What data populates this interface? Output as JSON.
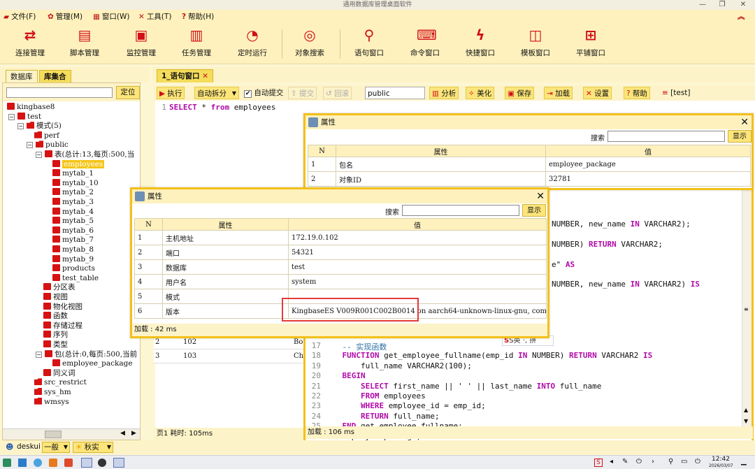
{
  "window": {
    "title": "通用数据库管理桌面软件"
  },
  "menu": [
    {
      "label": "文件(F)",
      "icon": "folder-icon"
    },
    {
      "label": "管理(M)",
      "icon": "gear-icon"
    },
    {
      "label": "窗口(W)",
      "icon": "windows-icon"
    },
    {
      "label": "工具(T)",
      "icon": "tools-icon"
    },
    {
      "label": "帮助(H)",
      "icon": "help-icon"
    }
  ],
  "toolbar": [
    {
      "label": "连接管理",
      "icon": "connect-icon"
    },
    {
      "label": "脚本管理",
      "icon": "script-icon"
    },
    {
      "label": "监控管理",
      "icon": "monitor-icon"
    },
    {
      "label": "任务管理",
      "icon": "calendar-icon"
    },
    {
      "label": "定时运行",
      "icon": "clock-icon"
    },
    {
      "label": "对象搜索",
      "icon": "object-search-icon"
    },
    {
      "label": "语句窗口",
      "icon": "search-icon"
    },
    {
      "label": "命令窗口",
      "icon": "command-icon"
    },
    {
      "label": "快捷窗口",
      "icon": "lightning-icon"
    },
    {
      "label": "模板窗口",
      "icon": "template-icon"
    },
    {
      "label": "平铺窗口",
      "icon": "tile-icon"
    }
  ],
  "left": {
    "tabs": [
      "数据库",
      "库集合"
    ],
    "locate_button": "定位",
    "tree": [
      {
        "label": "kingbase8",
        "level": 0,
        "icon": "server"
      },
      {
        "label": "test",
        "level": 1,
        "icon": "db",
        "exp": "−"
      },
      {
        "label": "模式(5)",
        "level": 2,
        "icon": "fold",
        "exp": "−"
      },
      {
        "label": "perf",
        "level": 3,
        "icon": "fold"
      },
      {
        "label": "public",
        "level": 3,
        "icon": "fold",
        "exp": "−"
      },
      {
        "label": "表(总计:13,每页:500,当",
        "level": 4,
        "icon": "tbl",
        "exp": "−"
      },
      {
        "label": "employees",
        "level": 5,
        "icon": "tbl",
        "selected": true
      },
      {
        "label": "mytab_1",
        "level": 5,
        "icon": "tbl"
      },
      {
        "label": "mytab_10",
        "level": 5,
        "icon": "tbl"
      },
      {
        "label": "mytab_2",
        "level": 5,
        "icon": "tbl"
      },
      {
        "label": "mytab_3",
        "level": 5,
        "icon": "tbl"
      },
      {
        "label": "mytab_4",
        "level": 5,
        "icon": "tbl"
      },
      {
        "label": "mytab_5",
        "level": 5,
        "icon": "tbl"
      },
      {
        "label": "mytab_6",
        "level": 5,
        "icon": "tbl"
      },
      {
        "label": "mytab_7",
        "level": 5,
        "icon": "tbl"
      },
      {
        "label": "mytab_8",
        "level": 5,
        "icon": "tbl"
      },
      {
        "label": "mytab_9",
        "level": 5,
        "icon": "tbl"
      },
      {
        "label": "products",
        "level": 5,
        "icon": "tbl"
      },
      {
        "label": "test_table",
        "level": 5,
        "icon": "tbl"
      },
      {
        "label": "分区表",
        "level": 4,
        "icon": "tbl"
      },
      {
        "label": "视图",
        "level": 4,
        "icon": "tbl"
      },
      {
        "label": "物化视图",
        "level": 4,
        "icon": "tbl"
      },
      {
        "label": "函数",
        "level": 4,
        "icon": "tbl"
      },
      {
        "label": "存储过程",
        "level": 4,
        "icon": "tbl"
      },
      {
        "label": "序列",
        "level": 4,
        "icon": "tbl"
      },
      {
        "label": "类型",
        "level": 4,
        "icon": "tbl"
      },
      {
        "label": "包(总计:0,每页:500,当前",
        "level": 4,
        "icon": "tbl",
        "exp": "−"
      },
      {
        "label": "employee_package",
        "level": 5,
        "icon": "tbl"
      },
      {
        "label": "同义词",
        "level": 4,
        "icon": "tbl"
      },
      {
        "label": "src_restrict",
        "level": 3,
        "icon": "fold"
      },
      {
        "label": "sys_hm",
        "level": 3,
        "icon": "fold"
      },
      {
        "label": "wmsys",
        "level": 3,
        "icon": "fold"
      }
    ]
  },
  "editor": {
    "tab": "1_语句窗口",
    "run": "执行",
    "autosplit": "自动拆分",
    "autocommit": "自动提交",
    "commit": "提交",
    "rollback": "回滚",
    "schema": "public",
    "analyze": "分析",
    "beautify": "美化",
    "save": "保存",
    "load": "加载",
    "settings": "设置",
    "help": "帮助",
    "dbtag": "[test]",
    "line1_num": "1",
    "line1_kw1": "SELECT",
    "line1_rest": " * ",
    "line1_kw2": "from",
    "line1_tail": " employees",
    "page_info": "页1 耗时: 105ms",
    "result_rows": [
      [
        "2",
        "102",
        "Bo"
      ],
      [
        "3",
        "103",
        "Ch"
      ]
    ]
  },
  "package_editor": {
    "lines": [
      {
        "n": "17",
        "t": "    -- 实现函数"
      },
      {
        "n": "18",
        "t": "    FUNCTION get_employee_fullname(emp_id IN NUMBER) RETURN VARCHAR2 IS"
      },
      {
        "n": "19",
        "t": "        full_name VARCHAR2(100);"
      },
      {
        "n": "20",
        "t": "    BEGIN"
      },
      {
        "n": "21",
        "t": "        SELECT first_name || ' ' || last_name INTO full_name"
      },
      {
        "n": "22",
        "t": "        FROM employees"
      },
      {
        "n": "23",
        "t": "        WHERE employee_id = emp_id;"
      },
      {
        "n": "24",
        "t": "        RETURN full_name;"
      },
      {
        "n": "25",
        "t": "    END get_employee_fullname;"
      },
      {
        "n": "26",
        "t": "END employee_package;"
      }
    ],
    "partial_lines": [
      "NUMBER, new_name IN VARCHAR2);",
      "NUMBER) RETURN VARCHAR2;",
      "e\" AS",
      "NUMBER, new_name IN VARCHAR2) IS"
    ],
    "footer": "加载 : 106 ms"
  },
  "dialog_pkg": {
    "title": "属性",
    "search_label": "搜索",
    "show_button": "显示",
    "headers": [
      "N",
      "属性",
      "值"
    ],
    "rows": [
      [
        "1",
        "包名",
        "employee_package"
      ],
      [
        "2",
        "对象ID",
        "32781"
      ]
    ]
  },
  "dialog_conn": {
    "title": "属性",
    "search_label": "搜索",
    "show_button": "显示",
    "headers": [
      "N",
      "属性",
      "值"
    ],
    "rows": [
      [
        "1",
        "主机地址",
        "172.19.0.102"
      ],
      [
        "2",
        "端口",
        "54321"
      ],
      [
        "3",
        "数据库",
        "test"
      ],
      [
        "4",
        "用户名",
        "system"
      ],
      [
        "5",
        "模式",
        ""
      ],
      [
        "6",
        "版本",
        "KingbaseES V009R001C002B0014 on aarch64-unknown-linux-gnu, compi..."
      ]
    ],
    "footer": "加载 : 42 ms"
  },
  "statusbar": {
    "user": "deskui",
    "mode": "一般",
    "theme": "秋实"
  },
  "ime": "S英 ·, 拼",
  "taskbar": {
    "time": "12:42",
    "date": "2026/03/07"
  },
  "colors": {
    "accent": "#d20f1b",
    "panel": "#fef1bd",
    "tab": "#f5dc5a",
    "highlight": "#e53a3a"
  }
}
